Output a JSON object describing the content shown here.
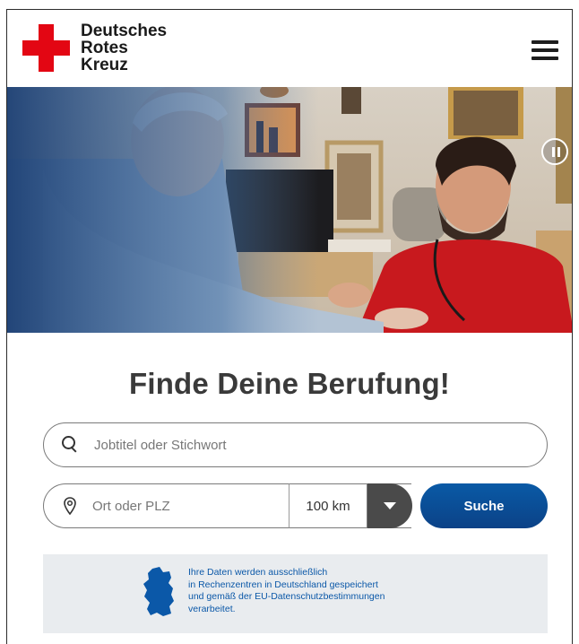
{
  "header": {
    "logo_lines": [
      "Deutsches",
      "Rotes",
      "Kreuz"
    ],
    "brand_color": "#e30613",
    "menu_icon": "hamburger-icon"
  },
  "hero": {
    "pause_icon": "pause-icon"
  },
  "main": {
    "headline": "Finde Deine Berufung!",
    "search": {
      "placeholder": "Jobtitel oder Stichwort",
      "icon": "search-icon"
    },
    "location": {
      "placeholder": "Ort oder PLZ",
      "icon": "location-pin-icon"
    },
    "radius": {
      "value": "100 km",
      "icon": "chevron-down-icon"
    },
    "submit_label": "Suche",
    "submit_color": "#0b4f9a"
  },
  "info_box": {
    "icon": "germany-map-icon",
    "lines": [
      "Ihre Daten werden ausschließlich",
      "in Rechenzentren in Deutschland gespeichert",
      "und gemäß der EU-Datenschutzbestimmungen",
      "verarbeitet."
    ],
    "text_color": "#0b58a8"
  }
}
